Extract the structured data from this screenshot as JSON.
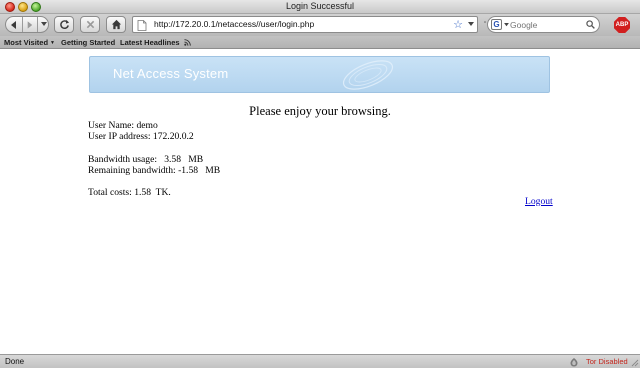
{
  "window": {
    "title": "Login Successful"
  },
  "toolbar": {
    "url": "http://172.20.0.1/netaccess//user/login.php",
    "search_placeholder": "Google",
    "search_engine": "G",
    "adblock_label": "ABP"
  },
  "bookmarks": {
    "items": [
      "Most Visited",
      "Getting Started",
      "Latest Headlines"
    ]
  },
  "page": {
    "banner_title": "Net Access System",
    "greeting": "Please enjoy your browsing.",
    "user_name_line": "User Name: demo",
    "user_ip_line": "User IP address: 172.20.0.2",
    "bandwidth_usage_line": "Bandwidth usage:   3.58   MB",
    "remaining_bandwidth_line": "Remaining bandwidth: -1.58   MB",
    "total_costs_line": "Total costs: 1.58  TK.",
    "logout_label": "Logout"
  },
  "status": {
    "text": "Done",
    "tor": "Tor Disabled"
  },
  "colors": {
    "banner": "#b8d7f0",
    "link": "#0000cc",
    "tor_status": "#c4261d"
  },
  "icons": {
    "back": "back-arrow-icon",
    "forward": "forward-arrow-icon",
    "reload": "reload-icon",
    "stop": "stop-icon",
    "home": "home-icon",
    "bookmark_star": "star-icon",
    "search": "magnifier-icon",
    "rss": "rss-icon",
    "tor": "onion-icon"
  }
}
